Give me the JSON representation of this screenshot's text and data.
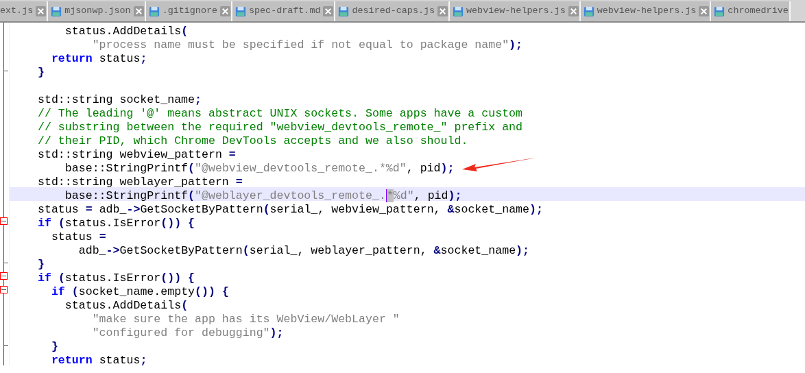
{
  "tabs": [
    {
      "label": "ext.js",
      "icon": false
    },
    {
      "label": "mjsonwp.json",
      "icon": true
    },
    {
      "label": ".gitignore",
      "icon": true
    },
    {
      "label": "spec-draft.md",
      "icon": true
    },
    {
      "label": "desired-caps.js",
      "icon": true
    },
    {
      "label": "webview-helpers.js",
      "icon": true
    },
    {
      "label": "webview-helpers.js",
      "icon": true
    },
    {
      "label": "chromedrive",
      "icon": true
    }
  ],
  "lines": [
    {
      "fold_start": false,
      "fold_end": false,
      "current": false,
      "segments": [
        {
          "kind": "txt",
          "text": "    status.AddDetails"
        },
        {
          "kind": "op",
          "text": "("
        }
      ]
    },
    {
      "fold_start": false,
      "fold_end": false,
      "current": false,
      "segments": [
        {
          "kind": "str",
          "text": "        \"process name must be specified if not equal to package name\""
        },
        {
          "kind": "op",
          "text": ");"
        }
      ]
    },
    {
      "fold_start": false,
      "fold_end": false,
      "current": false,
      "segments": [
        {
          "kind": "kw",
          "text": "  return"
        },
        {
          "kind": "txt",
          "text": " status"
        },
        {
          "kind": "op",
          "text": ";"
        }
      ]
    },
    {
      "fold_start": false,
      "fold_end": true,
      "current": false,
      "segments": [
        {
          "kind": "op",
          "text": "}"
        }
      ]
    },
    {
      "fold_start": false,
      "fold_end": false,
      "current": false,
      "blank_line_before": true,
      "segments": [
        {
          "kind": "txt",
          "text": "std::string socket_name"
        },
        {
          "kind": "op",
          "text": ";"
        }
      ]
    },
    {
      "fold_start": false,
      "fold_end": false,
      "current": false,
      "segments": [
        {
          "kind": "com",
          "text": "// The leading '@' means abstract UNIX sockets. Some apps have a custom"
        }
      ]
    },
    {
      "fold_start": false,
      "fold_end": false,
      "current": false,
      "segments": [
        {
          "kind": "com",
          "text": "// substring between the required \"webview_devtools_remote_\" prefix and"
        }
      ]
    },
    {
      "fold_start": false,
      "fold_end": false,
      "current": false,
      "segments": [
        {
          "kind": "com",
          "text": "// their PID, which Chrome DevTools accepts and we also should."
        }
      ]
    },
    {
      "fold_start": false,
      "fold_end": false,
      "current": false,
      "segments": [
        {
          "kind": "txt",
          "text": "std::string webview_pattern"
        },
        {
          "kind": "op",
          "text": " ="
        }
      ]
    },
    {
      "fold_start": false,
      "fold_end": false,
      "current": false,
      "segments": [
        {
          "kind": "txt",
          "text": "    base::StringPrintf"
        },
        {
          "kind": "op",
          "text": "("
        },
        {
          "kind": "str",
          "text": "\"@webview_devtools_remote_.*%d\""
        },
        {
          "kind": "txt",
          "text": ", pid"
        },
        {
          "kind": "op",
          "text": ");"
        }
      ]
    },
    {
      "fold_start": false,
      "fold_end": false,
      "current": false,
      "segments": [
        {
          "kind": "txt",
          "text": "std::string weblayer_pattern"
        },
        {
          "kind": "op",
          "text": " ="
        }
      ]
    },
    {
      "fold_start": false,
      "fold_end": false,
      "current": true,
      "segments": [
        {
          "kind": "txt",
          "text": "    base::StringPrintf"
        },
        {
          "kind": "op",
          "text": "("
        },
        {
          "kind": "str",
          "text": "\"@weblayer_devtools_remote_."
        },
        {
          "kind": "sel",
          "text": "*"
        },
        {
          "kind": "str",
          "text": "%d\""
        },
        {
          "kind": "txt",
          "text": ", pid"
        },
        {
          "kind": "op",
          "text": ");"
        }
      ]
    },
    {
      "fold_start": false,
      "fold_end": false,
      "current": false,
      "segments": [
        {
          "kind": "txt",
          "text": "status"
        },
        {
          "kind": "op",
          "text": " ="
        },
        {
          "kind": "txt",
          "text": " adb_"
        },
        {
          "kind": "op",
          "text": "->"
        },
        {
          "kind": "txt",
          "text": "GetSocketByPattern"
        },
        {
          "kind": "op",
          "text": "("
        },
        {
          "kind": "txt",
          "text": "serial_, webview_pattern,"
        },
        {
          "kind": "op",
          "text": " &"
        },
        {
          "kind": "txt",
          "text": "socket_name"
        },
        {
          "kind": "op",
          "text": ");"
        }
      ]
    },
    {
      "fold_start": true,
      "fold_end": false,
      "current": false,
      "segments": [
        {
          "kind": "kw",
          "text": "if"
        },
        {
          "kind": "op",
          "text": " ("
        },
        {
          "kind": "txt",
          "text": "status.IsError"
        },
        {
          "kind": "op",
          "text": "()) {"
        }
      ]
    },
    {
      "fold_start": false,
      "fold_end": false,
      "current": false,
      "segments": [
        {
          "kind": "txt",
          "text": "  status"
        },
        {
          "kind": "op",
          "text": " ="
        }
      ]
    },
    {
      "fold_start": false,
      "fold_end": false,
      "current": false,
      "segments": [
        {
          "kind": "txt",
          "text": "      adb_"
        },
        {
          "kind": "op",
          "text": "->"
        },
        {
          "kind": "txt",
          "text": "GetSocketByPattern"
        },
        {
          "kind": "op",
          "text": "("
        },
        {
          "kind": "txt",
          "text": "serial_, weblayer_pattern,"
        },
        {
          "kind": "op",
          "text": " &"
        },
        {
          "kind": "txt",
          "text": "socket_name"
        },
        {
          "kind": "op",
          "text": ");"
        }
      ]
    },
    {
      "fold_start": false,
      "fold_end": true,
      "current": false,
      "segments": [
        {
          "kind": "op",
          "text": "}"
        }
      ]
    },
    {
      "fold_start": true,
      "fold_end": false,
      "current": false,
      "segments": [
        {
          "kind": "kw",
          "text": "if"
        },
        {
          "kind": "op",
          "text": " ("
        },
        {
          "kind": "txt",
          "text": "status.IsError"
        },
        {
          "kind": "op",
          "text": "()) {"
        }
      ]
    },
    {
      "fold_start": true,
      "fold_end": false,
      "current": false,
      "segments": [
        {
          "kind": "kw",
          "text": "  if"
        },
        {
          "kind": "op",
          "text": " ("
        },
        {
          "kind": "txt",
          "text": "socket_name.empty"
        },
        {
          "kind": "op",
          "text": "()) {"
        }
      ]
    },
    {
      "fold_start": false,
      "fold_end": false,
      "current": false,
      "segments": [
        {
          "kind": "txt",
          "text": "    status.AddDetails"
        },
        {
          "kind": "op",
          "text": "("
        }
      ]
    },
    {
      "fold_start": false,
      "fold_end": false,
      "current": false,
      "segments": [
        {
          "kind": "str",
          "text": "        \"make sure the app has its WebView/WebLayer \""
        }
      ]
    },
    {
      "fold_start": false,
      "fold_end": false,
      "current": false,
      "segments": [
        {
          "kind": "str",
          "text": "        \"configured for debugging\""
        },
        {
          "kind": "op",
          "text": ");"
        }
      ]
    },
    {
      "fold_start": false,
      "fold_end": true,
      "current": false,
      "segments": [
        {
          "kind": "op",
          "text": "  }"
        }
      ]
    },
    {
      "fold_start": false,
      "fold_end": false,
      "current": false,
      "segments": [
        {
          "kind": "kw",
          "text": "  return"
        },
        {
          "kind": "txt",
          "text": " status"
        },
        {
          "kind": "op",
          "text": ";"
        }
      ]
    }
  ]
}
